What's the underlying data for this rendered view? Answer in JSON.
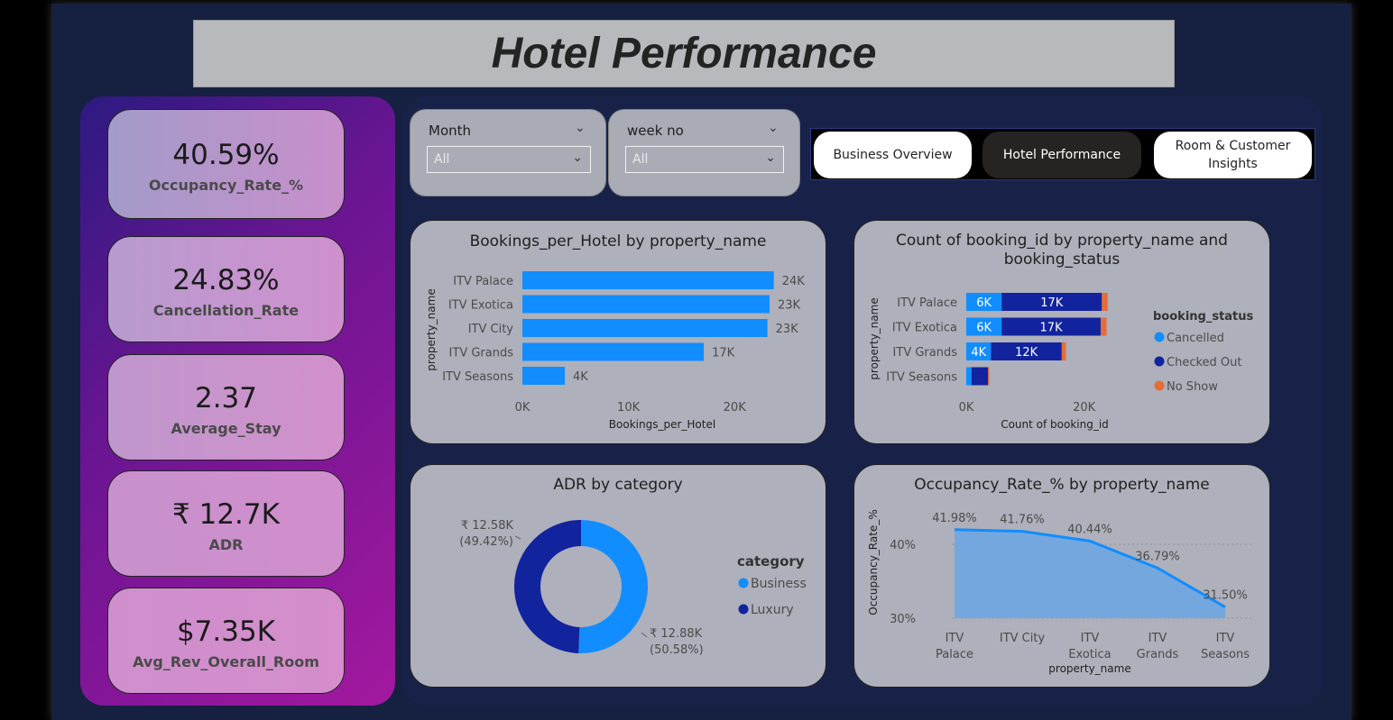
{
  "header": {
    "title": "Hotel Performance"
  },
  "kpis": [
    {
      "value": "40.59%",
      "label": "Occupancy_Rate_%"
    },
    {
      "value": "24.83%",
      "label": "Cancellation_Rate"
    },
    {
      "value": "2.37",
      "label": "Average_Stay"
    },
    {
      "value": "₹ 12.7K",
      "label": "ADR"
    },
    {
      "value": "$7.35K",
      "label": "Avg_Rev_Overall_Room"
    }
  ],
  "filters": {
    "month": {
      "title": "Month",
      "value": "All"
    },
    "week": {
      "title": "week no",
      "value": "All"
    }
  },
  "nav": {
    "business": "Business Overview",
    "hotel": "Hotel Performance",
    "room": "Room & Customer Insights"
  },
  "colors": {
    "blue": "#118dff",
    "navy": "#12239e",
    "orange": "#e66c37",
    "area": "#6fa6e3",
    "panel": "#aeb0bb"
  },
  "chart_data": [
    {
      "type": "bar",
      "title": "Bookings_per_Hotel by property_name",
      "xlabel": "Bookings_per_Hotel",
      "ylabel": "property_name",
      "categories": [
        "ITV Palace",
        "ITV Exotica",
        "ITV City",
        "ITV Grands",
        "ITV Seasons"
      ],
      "values": [
        23700,
        23300,
        23100,
        17100,
        4000
      ],
      "data_labels": [
        "24K",
        "23K",
        "23K",
        "17K",
        "4K"
      ],
      "xticks": [
        "0K",
        "10K",
        "20K"
      ],
      "xlim": [
        0,
        25000
      ]
    },
    {
      "type": "bar",
      "stacked": true,
      "title": "Count of booking_id by property_name and booking_status",
      "xlabel": "Count of booking_id",
      "ylabel": "property_name",
      "categories": [
        "ITV Palace",
        "ITV Exotica",
        "ITV Grands",
        "ITV Seasons"
      ],
      "legend_title": "booking_status",
      "series": [
        {
          "name": "Cancelled",
          "values": [
            6000,
            6000,
            4200,
            900
          ],
          "labels": [
            "6K",
            "6K",
            "4K",
            ""
          ]
        },
        {
          "name": "Checked Out",
          "values": [
            17000,
            16800,
            12000,
            2800
          ],
          "labels": [
            "17K",
            "17K",
            "12K",
            ""
          ]
        },
        {
          "name": "No Show",
          "values": [
            1000,
            1000,
            700,
            200
          ],
          "labels": [
            "",
            "",
            "",
            ""
          ]
        }
      ],
      "xticks": [
        "0K",
        "20K"
      ],
      "xlim": [
        0,
        30000
      ]
    },
    {
      "type": "pie",
      "donut": true,
      "title": "ADR by category",
      "legend_title": "category",
      "slices": [
        {
          "name": "Business",
          "value": 12.88,
          "label": "₹ 12.88K",
          "pct": "(50.58%)"
        },
        {
          "name": "Luxury",
          "value": 12.58,
          "label": "₹ 12.58K",
          "pct": "(49.42%)"
        }
      ]
    },
    {
      "type": "area",
      "title": "Occupancy_Rate_% by property_name",
      "xlabel": "property_name",
      "ylabel": "Occupancy_Rate_%",
      "categories": [
        [
          "ITV",
          "Palace"
        ],
        [
          "ITV City"
        ],
        [
          "ITV",
          "Exotica"
        ],
        [
          "ITV",
          "Grands"
        ],
        [
          "ITV",
          "Seasons"
        ]
      ],
      "values": [
        41.98,
        41.76,
        40.44,
        36.79,
        31.5
      ],
      "data_labels": [
        "41.98%",
        "41.76%",
        "40.44%",
        "36.79%",
        "31.50%"
      ],
      "yticks": [
        "40%",
        "30%"
      ],
      "ylim": [
        30,
        42.5
      ]
    }
  ]
}
